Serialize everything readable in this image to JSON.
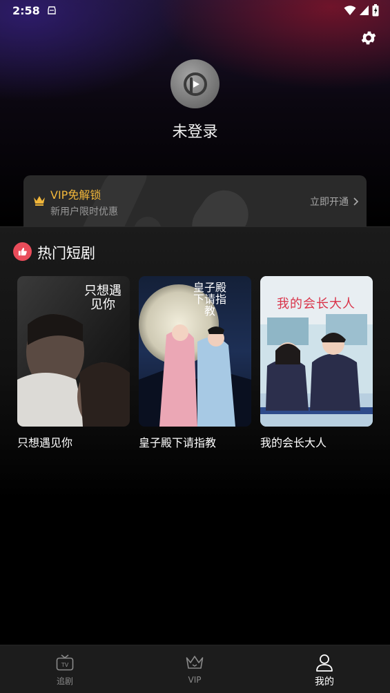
{
  "status_bar": {
    "time": "2:58"
  },
  "profile": {
    "name": "未登录"
  },
  "vip_card": {
    "title": "VIP免解锁",
    "subtitle": "新用户限时优惠",
    "action": "立即开通"
  },
  "hot_section": {
    "title": "热门短剧",
    "items": [
      {
        "title": "只想遇见你",
        "cover_text": "只想遇见你"
      },
      {
        "title": "皇子殿下请指教",
        "cover_text": "皇子殿下请指教"
      },
      {
        "title": "我的会长大人",
        "cover_text": "我的会长大人"
      }
    ]
  },
  "bottom_nav": {
    "items": [
      {
        "label": "追剧",
        "icon": "tv-icon",
        "active": false
      },
      {
        "label": "VIP",
        "icon": "crown-icon",
        "active": false
      },
      {
        "label": "我的",
        "icon": "user-icon",
        "active": true
      }
    ]
  },
  "colors": {
    "accent_gold": "#f2b73a",
    "hot_badge": "#e94c5a",
    "nav_bg": "#1c1c1c"
  }
}
